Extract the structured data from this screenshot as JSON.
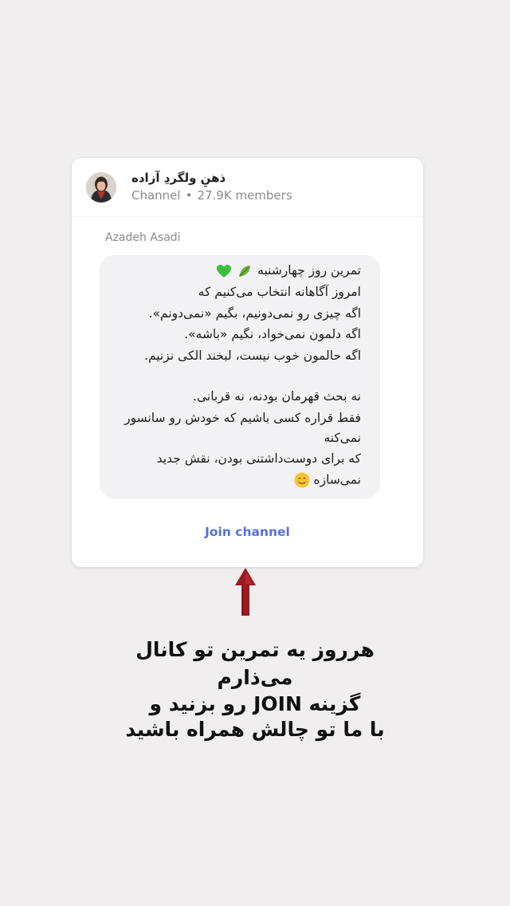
{
  "channel": {
    "name": "ذهنِ ولگردِ آزاده",
    "type": "Channel",
    "members": "27.9K members"
  },
  "post": {
    "sender": "Azadeh Asadi",
    "lines": [
      "تمرین روز چهارشنبه",
      "امروز آگاهانه انتخاب می‌کنیم که",
      "اگه چیزی رو نمی‌دونیم، بگیم «نمی‌دونم».",
      "اگه دلمون نمی‌خواد، نگیم «باشه».",
      "اگه حالمون خوب نیست، لبخند الکی نزنیم.",
      "نه بحث قهرمان بودنه، نه قربانی.",
      "فقط قراره کسی باشیم که خودش رو سانسور",
      "نمی‌کنه",
      "که برای دوست‌داشتنی بودن، نقش جدید",
      "نمی‌سازه"
    ],
    "emojis": [
      "green-heart",
      "herb",
      "smiling-face"
    ]
  },
  "join_label": "Join channel",
  "caption": {
    "lines": [
      "هرروز یه تمرین تو کانال",
      "می‌ذارم",
      "گزینه JOIN رو بزنید و",
      "با ما تو چالش همراه باشید"
    ]
  },
  "colors": {
    "background": "#f0eeee",
    "card": "#ffffff",
    "bubble": "#f2f2f5",
    "accent": "#5570d8",
    "arrow": "#9b1b1f"
  }
}
